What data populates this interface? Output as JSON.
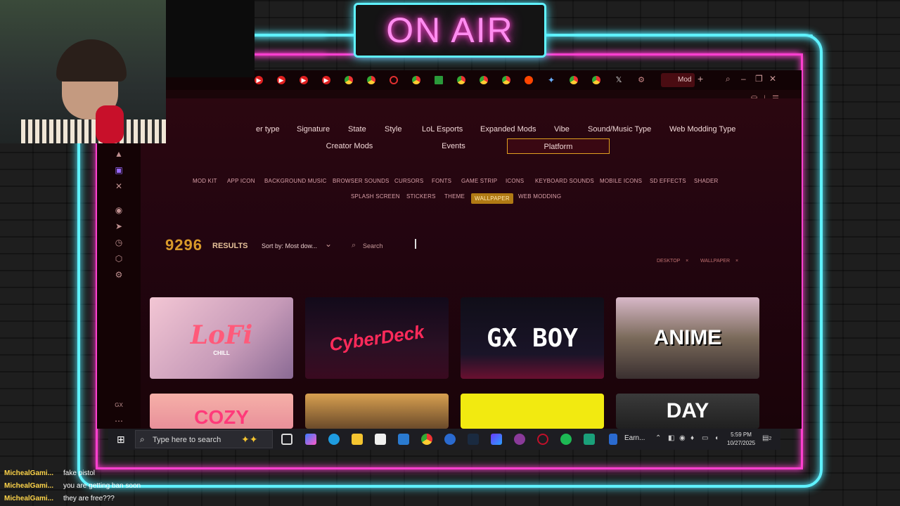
{
  "overlay": {
    "on_air": "ON AIR"
  },
  "browser": {
    "active_tab_label": "Mod",
    "tab_icons": [
      "youtube-icon",
      "youtube-icon",
      "youtube-icon",
      "youtube-icon",
      "chrome-icon",
      "chrome-icon",
      "opera-icon",
      "chrome-icon",
      "apps-grid-icon",
      "chrome-icon",
      "chrome-icon",
      "chrome-icon",
      "reddit-icon",
      "gemini-icon",
      "chrome-icon",
      "chrome-icon",
      "x-icon",
      "gear-icon"
    ]
  },
  "nav": {
    "categories": [
      "er type",
      "Signature",
      "State",
      "Style",
      "LoL Esports",
      "Expanded Mods",
      "Vibe",
      "Sound/Music Type",
      "Web Modding Type"
    ],
    "subtabs": [
      "Creator Mods",
      "Events",
      "Platform"
    ],
    "active_subtab": "Platform",
    "chips_row1": [
      "MOD KIT",
      "APP ICON",
      "BACKGROUND MUSIC",
      "BROWSER SOUNDS",
      "CURSORS",
      "FONTS",
      "GAME STRIP",
      "ICONS",
      "KEYBOARD SOUNDS",
      "MOBILE ICONS",
      "SD EFFECTS",
      "SHADER"
    ],
    "chips_row2": [
      "SPLASH SCREEN",
      "STICKERS",
      "THEME",
      "WALLPAPER",
      "WEB MODDING"
    ],
    "selected_chip": "WALLPAPER"
  },
  "results": {
    "count": "9296",
    "label": "RESULTS",
    "sort_label": "Sort by: Most dow...",
    "search_placeholder": "Search",
    "filters": [
      {
        "label": "DESKTOP",
        "remove": "×"
      },
      {
        "label": "WALLPAPER",
        "remove": "×"
      }
    ]
  },
  "thumbnails": [
    {
      "title": "LoFi",
      "subtitle": "CHILL"
    },
    {
      "title": "CyberDeck"
    },
    {
      "title": "GX BOY"
    },
    {
      "title": "ANIME"
    },
    {
      "title": "COZY"
    },
    {
      "title": ""
    },
    {
      "title": ""
    },
    {
      "title": "DAY"
    }
  ],
  "taskbar": {
    "search_placeholder": "Type here to search",
    "earn_label": "Earn...",
    "time": "5:59 PM",
    "date": "10/27/2025",
    "notification_count": "2"
  },
  "chat": [
    {
      "user": "MichealGami...",
      "message": "fake pistol"
    },
    {
      "user": "MichealGami...",
      "message": "you are getting ban soon"
    },
    {
      "user": "MichealGami...",
      "message": "they are free???"
    }
  ],
  "colors": {
    "neon_cyan": "#5ff2ff",
    "neon_pink": "#ff3fd0",
    "accent_gold": "#d99a2a",
    "chat_user": "#ffd54a"
  }
}
